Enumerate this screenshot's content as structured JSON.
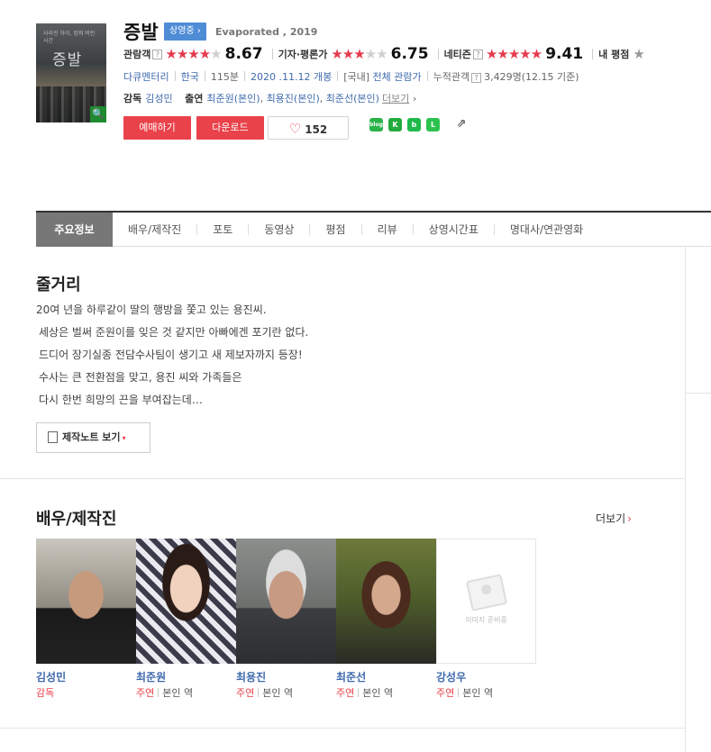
{
  "movie": {
    "title": "증발",
    "status_badge": "상영중",
    "status_arrow": "›",
    "english_title": "Evaporated , 2019",
    "poster_title": "증발",
    "poster_subtitle": "사라진 아이, 멈춰 버린 시간",
    "zoom_icon": "🔍"
  },
  "ratings": [
    {
      "label": "관람객",
      "help": "?",
      "stars_full": "★★★★",
      "stars_half": "★",
      "stars_empty": "",
      "score": "8.67"
    },
    {
      "label": "기자·평론가",
      "help": "",
      "stars_full": "★★★",
      "stars_half": "★",
      "stars_empty": "★",
      "score": "6.75"
    },
    {
      "label": "네티즌",
      "help": "?",
      "stars_full": "★★★★★",
      "stars_half": "",
      "stars_empty": "",
      "score": "9.41"
    },
    {
      "label": "내 평점",
      "help": "",
      "stars_full": "",
      "stars_half": "",
      "stars_empty": "★",
      "score": ""
    }
  ],
  "info": {
    "genre": "다큐멘터리",
    "country": "한국",
    "runtime": "115분",
    "release": "2020 .11.12 개봉",
    "rating_prefix": "[국내]",
    "rating": "전체 관람가",
    "audience_label": "누적관객",
    "audience_help": "?",
    "audience": "3,429명(12.15 기준)"
  },
  "credits": {
    "director_label": "감독",
    "director": "김성민",
    "cast_label": "출연",
    "cast": [
      "최준원(본인)",
      "최용진(본인)",
      "최준선(본인)"
    ],
    "more": "더보기",
    "more_arrow": "›"
  },
  "buttons": {
    "reserve": "예매하기",
    "download": "다운로드",
    "like_icon": "♡",
    "like_count": "152"
  },
  "share": {
    "blog": "blog",
    "kakao": "K",
    "band": "b",
    "line": "L",
    "share_icon": "⇗"
  },
  "tabs": [
    "주요정보",
    "배우/제작진",
    "포토",
    "동영상",
    "평점",
    "리뷰",
    "상영시간표",
    "명대사/연관영화"
  ],
  "synopsis": {
    "heading": "줄거리",
    "lines": [
      "20여 년을 하루같이 딸의 행방을 쫓고 있는 용진씨.",
      "세상은 벌써 준원이를 잊은 것 같지만 아빠에겐 포기란 없다.",
      "드디어 장기실종 전담수사팀이 생기고 새 제보자까지 등장!",
      "수사는 큰 전환점을 맞고, 용진 씨와 가족들은",
      "다시 한번 희망의 끈을 부여잡는데…"
    ],
    "notes_button": "제작노트 보기",
    "notes_caret": "▾"
  },
  "cast_section": {
    "heading": "배우/제작진",
    "more": "더보기",
    "more_arrow": "›",
    "no_image_text": "이미지 준비중",
    "people": [
      {
        "name": "김성민",
        "role_type": "감독",
        "role": ""
      },
      {
        "name": "최준원",
        "role_type": "주연",
        "role": "본인 역"
      },
      {
        "name": "최용진",
        "role_type": "주연",
        "role": "본인 역"
      },
      {
        "name": "최준선",
        "role_type": "주연",
        "role": "본인 역"
      },
      {
        "name": "강성우",
        "role_type": "주연",
        "role": "본인 역"
      }
    ]
  }
}
